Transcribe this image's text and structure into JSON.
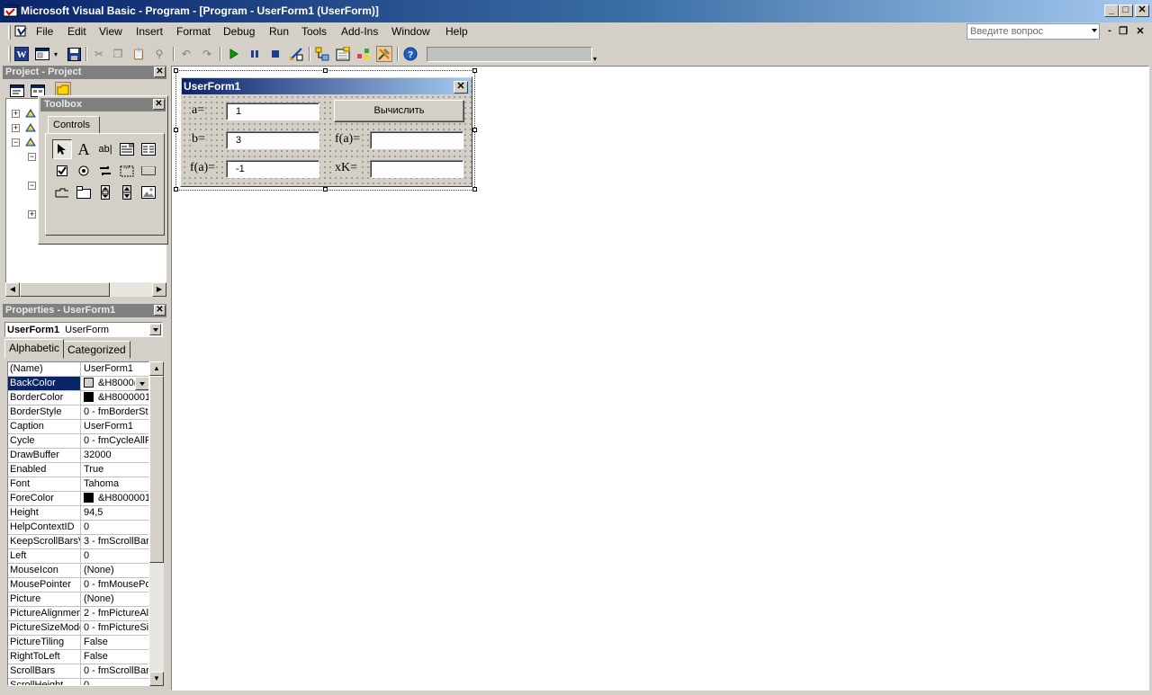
{
  "window": {
    "title": "Microsoft Visual Basic - Program - [Program - UserForm1 (UserForm)]",
    "minimize": "_",
    "maximize": "□",
    "close": "✕"
  },
  "menu": {
    "items": [
      "File",
      "Edit",
      "View",
      "Insert",
      "Format",
      "Debug",
      "Run",
      "Tools",
      "Add-Ins",
      "Window",
      "Help"
    ],
    "ask_placeholder": "Введите вопрос",
    "mdi_min": "-",
    "mdi_restore": "❐",
    "mdi_close": "✕"
  },
  "toolbar": {
    "icons": [
      "word-icon",
      "insert-userform-icon",
      "save-icon",
      "cut-icon",
      "copy-icon",
      "paste-icon",
      "find-icon",
      "undo-icon",
      "redo-icon",
      "run-icon",
      "break-icon",
      "reset-icon",
      "design-mode-icon",
      "project-explorer-icon",
      "properties-window-icon",
      "object-browser-icon",
      "toolbox-icon",
      "help-icon"
    ]
  },
  "project": {
    "title": "Project - Project",
    "close": "✕"
  },
  "toolbox": {
    "title": "Toolbox",
    "close": "✕",
    "tab": "Controls",
    "tools": [
      {
        "name": "select-objects-tool",
        "glyph": "➤"
      },
      {
        "name": "label-tool",
        "glyph": "A"
      },
      {
        "name": "textbox-tool",
        "glyph": "ab|"
      },
      {
        "name": "combobox-tool",
        "glyph": "▤"
      },
      {
        "name": "listbox-tool",
        "glyph": "☰"
      },
      {
        "name": "checkbox-tool",
        "glyph": "☑"
      },
      {
        "name": "optionbutton-tool",
        "glyph": "◉"
      },
      {
        "name": "togglebutton-tool",
        "glyph": "⇌"
      },
      {
        "name": "frame-tool",
        "glyph": "▭"
      },
      {
        "name": "commandbutton-tool",
        "glyph": "▬"
      },
      {
        "name": "tabstrip-tool",
        "glyph": "⊓"
      },
      {
        "name": "multipage-tool",
        "glyph": "▢"
      },
      {
        "name": "scrollbar-tool",
        "glyph": "⇕"
      },
      {
        "name": "spinbutton-tool",
        "glyph": "⬍"
      },
      {
        "name": "image-tool",
        "glyph": "▨"
      }
    ]
  },
  "properties": {
    "title": "Properties - UserForm1",
    "close": "✕",
    "object_name": "UserForm1",
    "object_type": "UserForm",
    "tab_alphabetic": "Alphabetic",
    "tab_categorized": "Categorized",
    "rows": [
      {
        "name": "(Name)",
        "value": "UserForm1"
      },
      {
        "name": "BackColor",
        "value": "&H8000(",
        "swatch": "#d4d0c8",
        "selected": true
      },
      {
        "name": "BorderColor",
        "value": "&H8000001",
        "swatch": "#000000"
      },
      {
        "name": "BorderStyle",
        "value": "0 - fmBorderSt"
      },
      {
        "name": "Caption",
        "value": "UserForm1"
      },
      {
        "name": "Cycle",
        "value": "0 - fmCycleAllF"
      },
      {
        "name": "DrawBuffer",
        "value": "32000"
      },
      {
        "name": "Enabled",
        "value": "True"
      },
      {
        "name": "Font",
        "value": "Tahoma"
      },
      {
        "name": "ForeColor",
        "value": "&H8000001",
        "swatch": "#000000"
      },
      {
        "name": "Height",
        "value": "94,5"
      },
      {
        "name": "HelpContextID",
        "value": "0"
      },
      {
        "name": "KeepScrollBarsVi",
        "value": "3 - fmScrollBar"
      },
      {
        "name": "Left",
        "value": "0"
      },
      {
        "name": "MouseIcon",
        "value": "(None)"
      },
      {
        "name": "MousePointer",
        "value": "0 - fmMousePo"
      },
      {
        "name": "Picture",
        "value": "(None)"
      },
      {
        "name": "PictureAlignment",
        "value": "2 - fmPictureAl"
      },
      {
        "name": "PictureSizeMode",
        "value": "0 - fmPictureSi"
      },
      {
        "name": "PictureTiling",
        "value": "False"
      },
      {
        "name": "RightToLeft",
        "value": "False"
      },
      {
        "name": "ScrollBars",
        "value": "0 - fmScrollBar"
      },
      {
        "name": "ScrollHeight",
        "value": "0"
      }
    ]
  },
  "userform": {
    "title": "UserForm1",
    "close": "✕",
    "labels": {
      "a": "a=",
      "b": "b=",
      "fa_left": "f(a)=",
      "fa_right": "f(a)=",
      "xk": "xK="
    },
    "fields": {
      "a": "1",
      "b": "3",
      "fa_left": "-1",
      "fa_right": "",
      "xk": ""
    },
    "button": "Вычислить"
  }
}
